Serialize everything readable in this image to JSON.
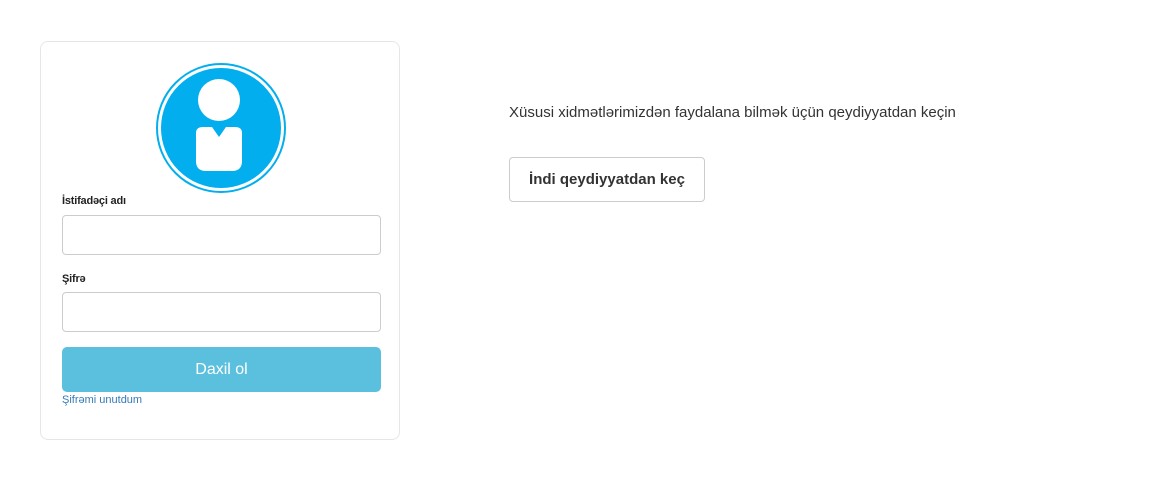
{
  "login": {
    "avatar_icon": "user-avatar-icon",
    "username_label": "İstifadəçi adı",
    "username_value": "",
    "password_label": "Şifrə",
    "password_value": "",
    "submit_label": "Daxil ol",
    "forgot_label": "Şifrəmi unutdum"
  },
  "register": {
    "text": "Xüsusi xidmətlərimizdən faydalana bilmək üçün qeydiyyatdan keçin",
    "button_label": "İndi qeydiyyatdan keç"
  },
  "colors": {
    "avatar_blue": "#03aeef",
    "login_button": "#5bc0de",
    "link": "#337ab7"
  }
}
